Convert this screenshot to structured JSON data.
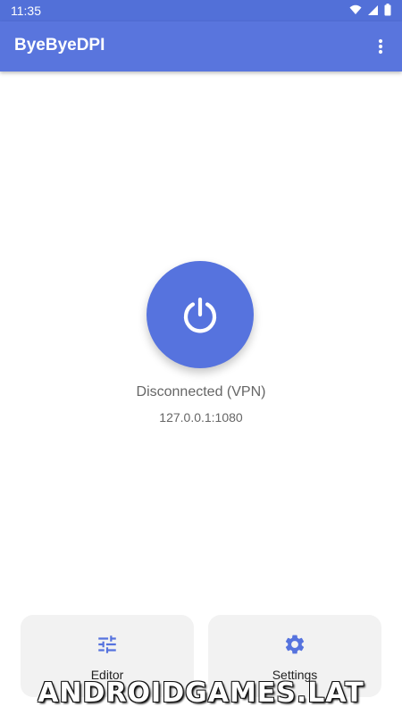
{
  "status_bar": {
    "time": "11:35",
    "icons": [
      "wifi-icon",
      "signal-icon",
      "battery-icon"
    ]
  },
  "app_bar": {
    "title": "ByeByeDPI",
    "menu_icon": "more-vert-icon"
  },
  "main": {
    "power_icon": "power-icon",
    "connection_status": "Disconnected (VPN)",
    "proxy_address": "127.0.0.1:1080"
  },
  "bottom_cards": [
    {
      "label": "Editor",
      "icon": "tune-sliders-icon"
    },
    {
      "label": "Settings",
      "icon": "gear-icon"
    }
  ],
  "watermark": "ANDROIDGAMES.LAT",
  "colors": {
    "primary": "#5975dd",
    "status_bar": "#5270d8",
    "power_button": "#5673de",
    "card_bg": "#f2f2f2",
    "secondary_text": "#666666"
  }
}
